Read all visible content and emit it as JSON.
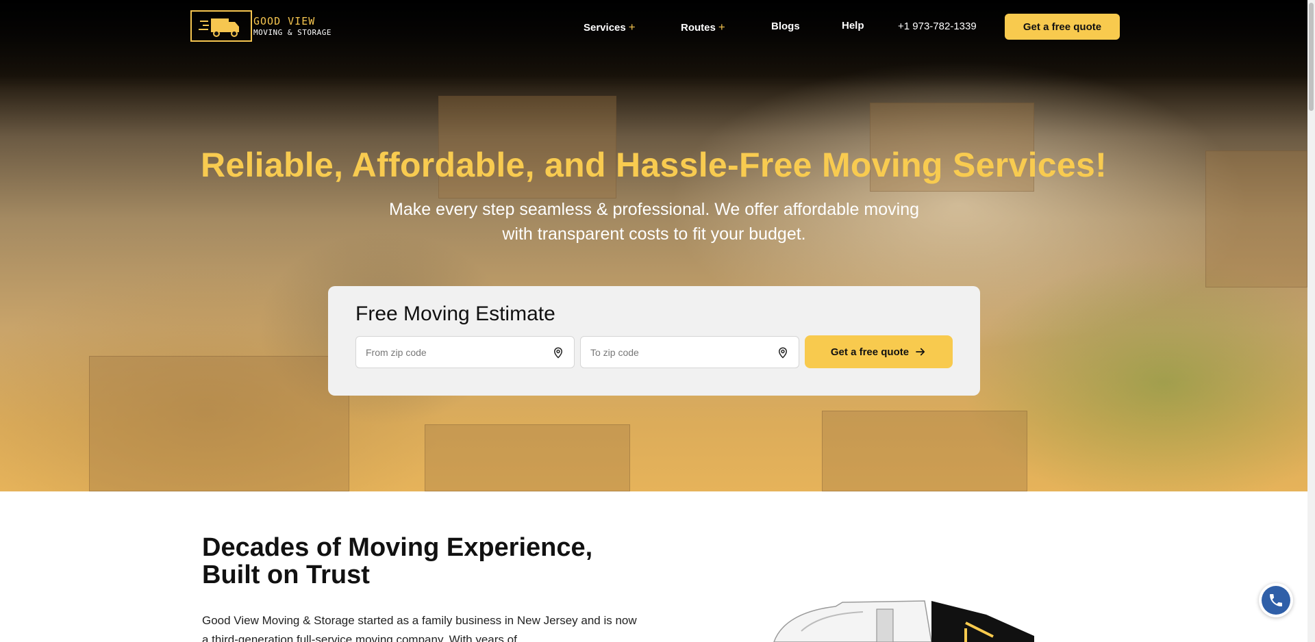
{
  "brand": {
    "line1": "GOOD VIEW",
    "line2": "MOVING & STORAGE",
    "accent": "#f8ca4e"
  },
  "nav": {
    "items": [
      {
        "label": "Services",
        "plus": "+"
      },
      {
        "label": "Routes",
        "plus": "+"
      },
      {
        "label": "Blogs"
      },
      {
        "label": "Help"
      }
    ],
    "phone": "+1 973-782-1339",
    "cta": "Get a free quote"
  },
  "hero": {
    "title": "Reliable, Affordable, and Hassle-Free Moving Services!",
    "subtitle": "Make every step seamless & professional. We offer affordable moving with transparent costs to fit your budget."
  },
  "estimate": {
    "title": "Free Moving Estimate",
    "from_placeholder": "From zip code",
    "to_placeholder": "To zip code",
    "button": "Get a free quote",
    "icons": {
      "location": "location-pin-icon",
      "arrow": "arrow-right-icon"
    }
  },
  "about": {
    "title_line1": "Decades of Moving Experience,",
    "title_line2": "Built on Trust",
    "text": "Good View Moving & Storage started as a family business in New Jersey and is now a third-generation full-service moving company. With years of"
  },
  "floating": {
    "icon": "phone-icon"
  }
}
